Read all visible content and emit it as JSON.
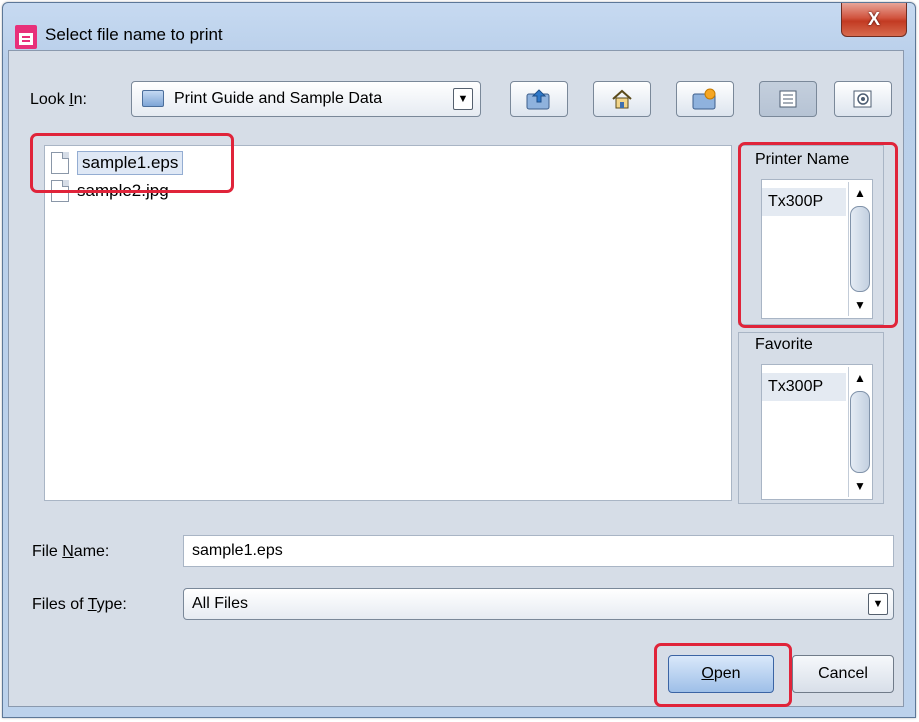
{
  "window": {
    "title": "Select file name to print",
    "close_label": "X"
  },
  "toolbar": {
    "look_in_label_pre": "Look ",
    "look_in_label_key": "I",
    "look_in_label_post": "n:",
    "look_in_value": "Print Guide and Sample Data",
    "buttons": [
      {
        "name": "up-folder",
        "icon": "folder-up-icon"
      },
      {
        "name": "home",
        "icon": "home-icon"
      },
      {
        "name": "new-folder",
        "icon": "new-folder-icon"
      },
      {
        "name": "list-view",
        "icon": "list-view-icon"
      },
      {
        "name": "details-view",
        "icon": "details-view-icon"
      }
    ]
  },
  "files": [
    {
      "name": "sample1.eps",
      "selected": true
    },
    {
      "name": "sample2.jpg",
      "selected": false
    }
  ],
  "printer_panel": {
    "title": "Printer Name",
    "items": [
      "Tx300P"
    ]
  },
  "favorite_panel": {
    "title": "Favorite",
    "items": [
      "Tx300P"
    ]
  },
  "file_name": {
    "label_pre": "File ",
    "label_key": "N",
    "label_post": "ame:",
    "value": "sample1.eps"
  },
  "file_type": {
    "label_pre": "Files of ",
    "label_key": "T",
    "label_post": "ype:",
    "value": "All Files"
  },
  "buttons": {
    "open_key": "O",
    "open_rest": "pen",
    "cancel": "Cancel"
  },
  "colors": {
    "highlight": "#e0243a",
    "accent": "#3b64a4"
  }
}
